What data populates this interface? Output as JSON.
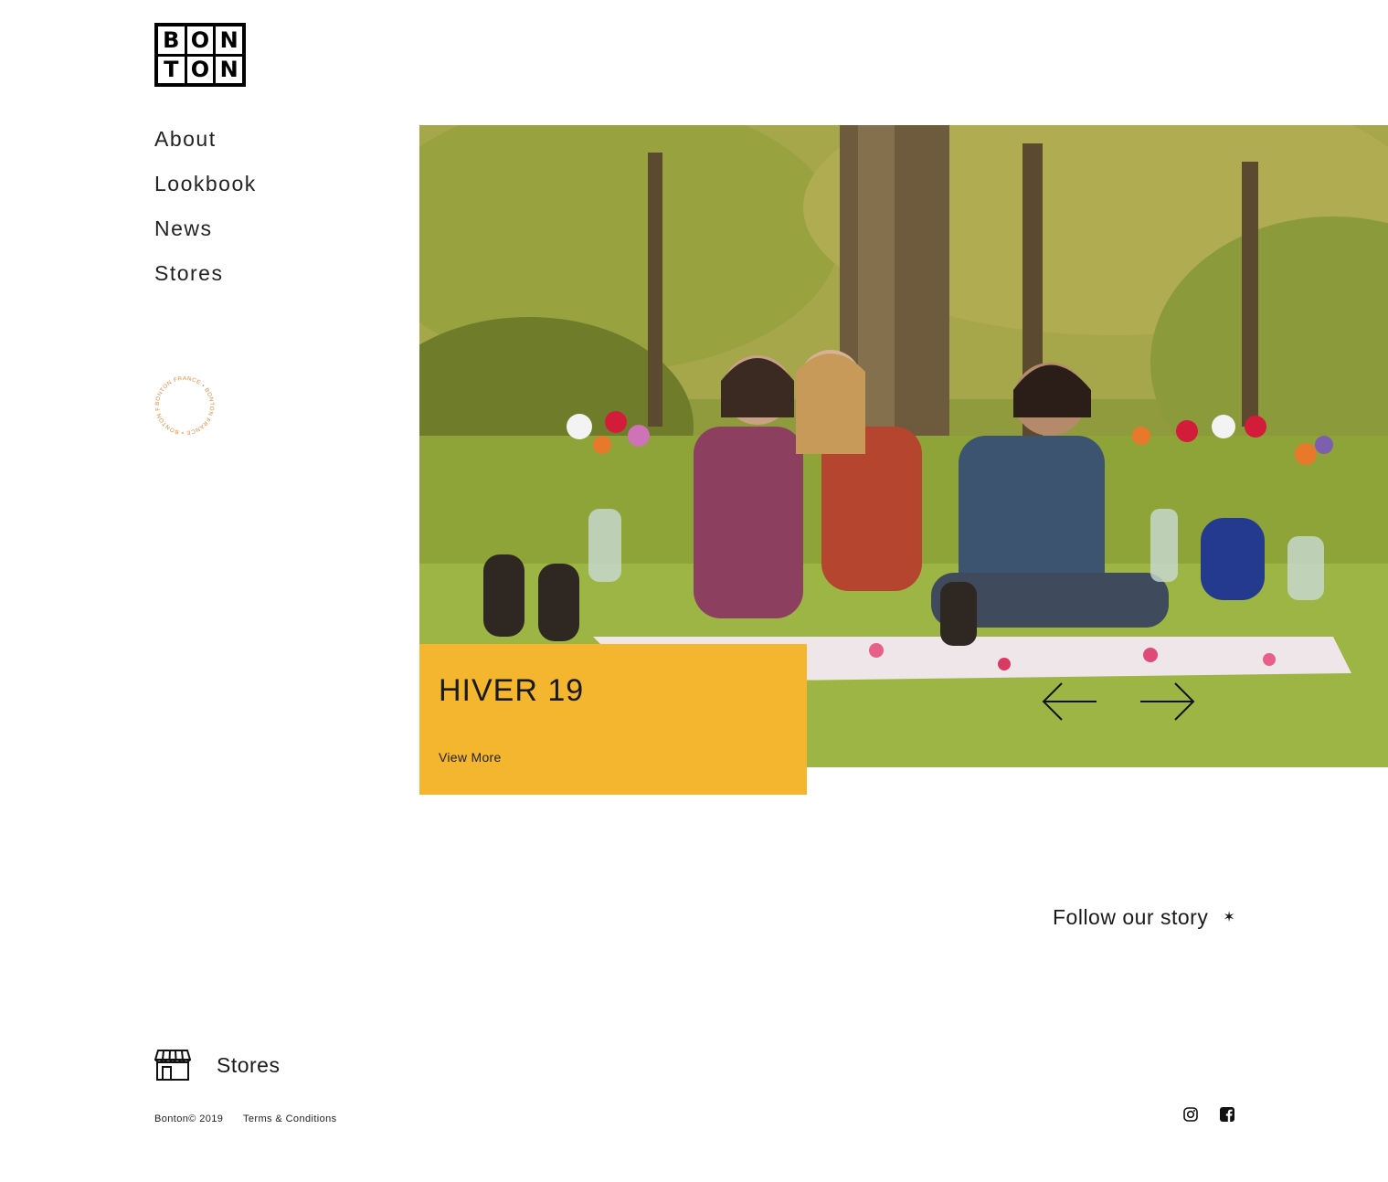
{
  "brand": {
    "logo_letters": [
      "B",
      "O",
      "N",
      "T",
      "O",
      "N"
    ]
  },
  "nav": {
    "items": [
      {
        "label": "About"
      },
      {
        "label": "Lookbook"
      },
      {
        "label": "News"
      },
      {
        "label": "Stores"
      }
    ]
  },
  "badge": {
    "text": "BONTON FRANCE • BONTON FRANCE • BONTON FRANCE •",
    "color": "#e28a3a"
  },
  "hero": {
    "caption_title": "HIVER 19",
    "caption_link": "View More",
    "caption_color": "#f4b62f",
    "prev_icon": "arrow-left-icon",
    "next_icon": "arrow-right-icon"
  },
  "follow": {
    "label": "Follow our story",
    "icon": "star-icon",
    "glyph": "✶"
  },
  "footer": {
    "stores_label": "Stores",
    "stores_icon": "storefront-icon",
    "copyright": "Bonton© 2019",
    "terms": "Terms & Conditions",
    "social": [
      "instagram-icon",
      "facebook-icon"
    ]
  }
}
